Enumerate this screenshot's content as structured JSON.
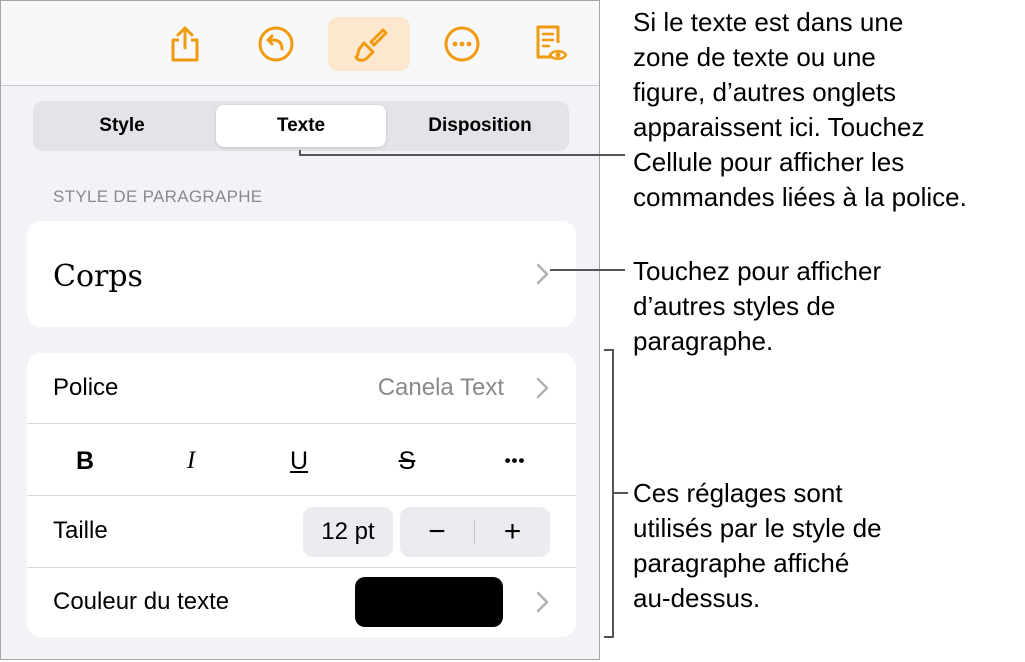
{
  "toolbar": {
    "icons": [
      "share-icon",
      "undo-icon",
      "paintbrush-icon",
      "more-icon",
      "document-view-icon"
    ],
    "accent_color": "#f09a0e",
    "active_bg": "#fde8cf"
  },
  "tabs": [
    {
      "label": "Style",
      "selected": false
    },
    {
      "label": "Texte",
      "selected": true
    },
    {
      "label": "Disposition",
      "selected": false
    }
  ],
  "paragraph_style": {
    "section_label": "STYLE DE PARAGRAPHE",
    "current": "Corps"
  },
  "font": {
    "label": "Police",
    "value": "Canela Text"
  },
  "format_buttons": [
    {
      "label": "B",
      "name": "bold"
    },
    {
      "label": "I",
      "name": "italic"
    },
    {
      "label": "U",
      "name": "underline"
    },
    {
      "label": "S",
      "name": "strikethrough"
    },
    {
      "label": "•••",
      "name": "more-formats"
    }
  ],
  "size": {
    "label": "Taille",
    "value": "12 pt",
    "minus": "−",
    "plus": "+"
  },
  "text_color": {
    "label": "Couleur du texte",
    "swatch": "#000000"
  },
  "callouts": {
    "tabs_note": [
      "Si le texte est dans une",
      "zone de texte ou une",
      "figure, d’autres onglets",
      "apparaissent ici. Touchez",
      "Cellule pour afficher les",
      "commandes liées à la police."
    ],
    "style_note": [
      "Touchez pour afficher",
      "d’autres styles de",
      "paragraphe."
    ],
    "settings_note": [
      "Ces réglages sont",
      "utilisés par le style de",
      "paragraphe affiché",
      "au-dessus."
    ]
  }
}
